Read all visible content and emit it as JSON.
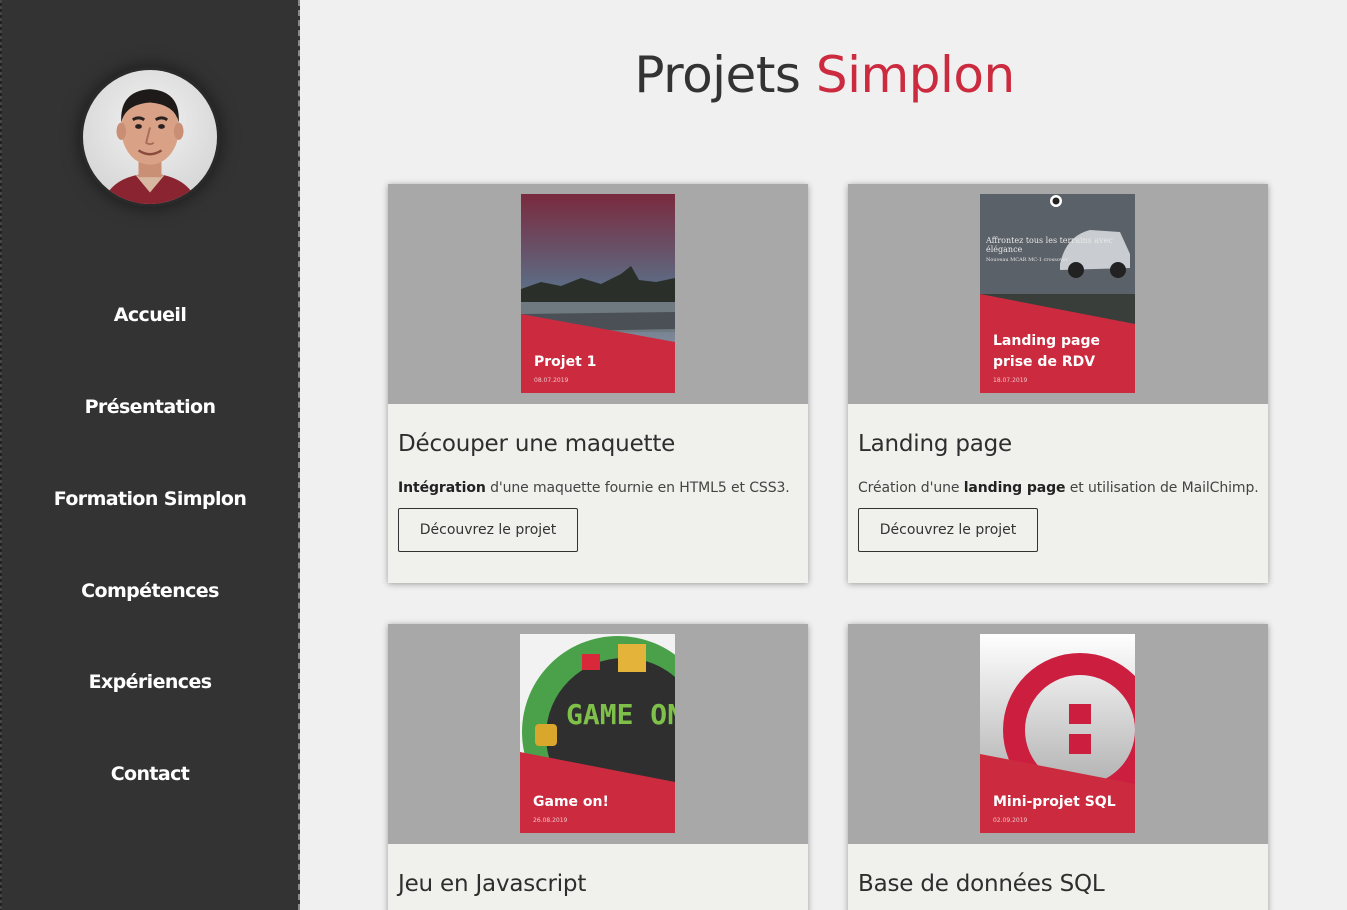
{
  "sidebar": {
    "nav": [
      "Accueil",
      "Présentation",
      "Formation Simplon",
      "Compétences",
      "Expériences",
      "Contact"
    ]
  },
  "header": {
    "title_main": "Projets",
    "title_accent": "Simplon"
  },
  "colors": {
    "accent": "#cc2b3f",
    "sidebar_bg": "#333333",
    "page_bg": "#f0f0f0"
  },
  "projects": [
    {
      "thumb_title": "Projet 1",
      "thumb_date": "08.07.2019",
      "heading": "Découper une maquette",
      "desc_bold": "Intégration",
      "desc_rest": " d'une maquette fournie en HTML5 et CSS3.",
      "button": "Découvrez le projet"
    },
    {
      "thumb_title": "Landing page prise de RDV",
      "thumb_date": "18.07.2019",
      "thumb_overlay": "Affrontez tous les terrains avec élégance",
      "thumb_overlay_sub": "Nouveau MCAR MC-1 crossover",
      "heading": "Landing page",
      "desc_pre": "Création d'une ",
      "desc_bold": "landing page",
      "desc_rest": " et utilisation de MailChimp.",
      "button": "Découvrez le projet"
    },
    {
      "thumb_title": "Game on!",
      "thumb_date": "26.08.2019",
      "thumb_art_text": "GAME ON",
      "heading": "Jeu en Javascript"
    },
    {
      "thumb_title": "Mini-projet SQL",
      "thumb_date": "02.09.2019",
      "heading": "Base de données SQL"
    }
  ]
}
